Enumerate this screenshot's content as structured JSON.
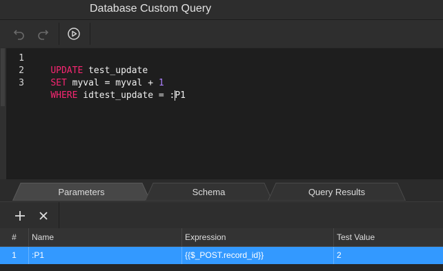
{
  "window": {
    "title": "Database Custom Query"
  },
  "toolbar": {
    "undo": "undo-icon",
    "redo": "redo-icon",
    "run": "play-icon"
  },
  "editor": {
    "lines": [
      {
        "number": "1",
        "keyword": "UPDATE",
        "text": " test_update"
      },
      {
        "number": "2",
        "keyword": "SET",
        "text": " myval = myval + ",
        "number_literal": "1"
      },
      {
        "number": "3",
        "keyword": "WHERE",
        "text": " idtest_update = :",
        "after_cursor": "P1"
      }
    ]
  },
  "tabs": [
    {
      "label": "Parameters",
      "active": true
    },
    {
      "label": "Schema",
      "active": false
    },
    {
      "label": "Query Results",
      "active": false
    }
  ],
  "params_toolbar": {
    "add": "plus-icon",
    "remove": "close-icon"
  },
  "grid": {
    "columns": [
      "#",
      "Name",
      "Expression",
      "Test Value"
    ],
    "rows": [
      {
        "index": "1",
        "name": ":P1",
        "expression": "{{$_POST.record_id}}",
        "test_value": "2"
      }
    ]
  },
  "colors": {
    "keyword": "#f92672",
    "number": "#ae81ff",
    "selection": "#3399ff"
  }
}
